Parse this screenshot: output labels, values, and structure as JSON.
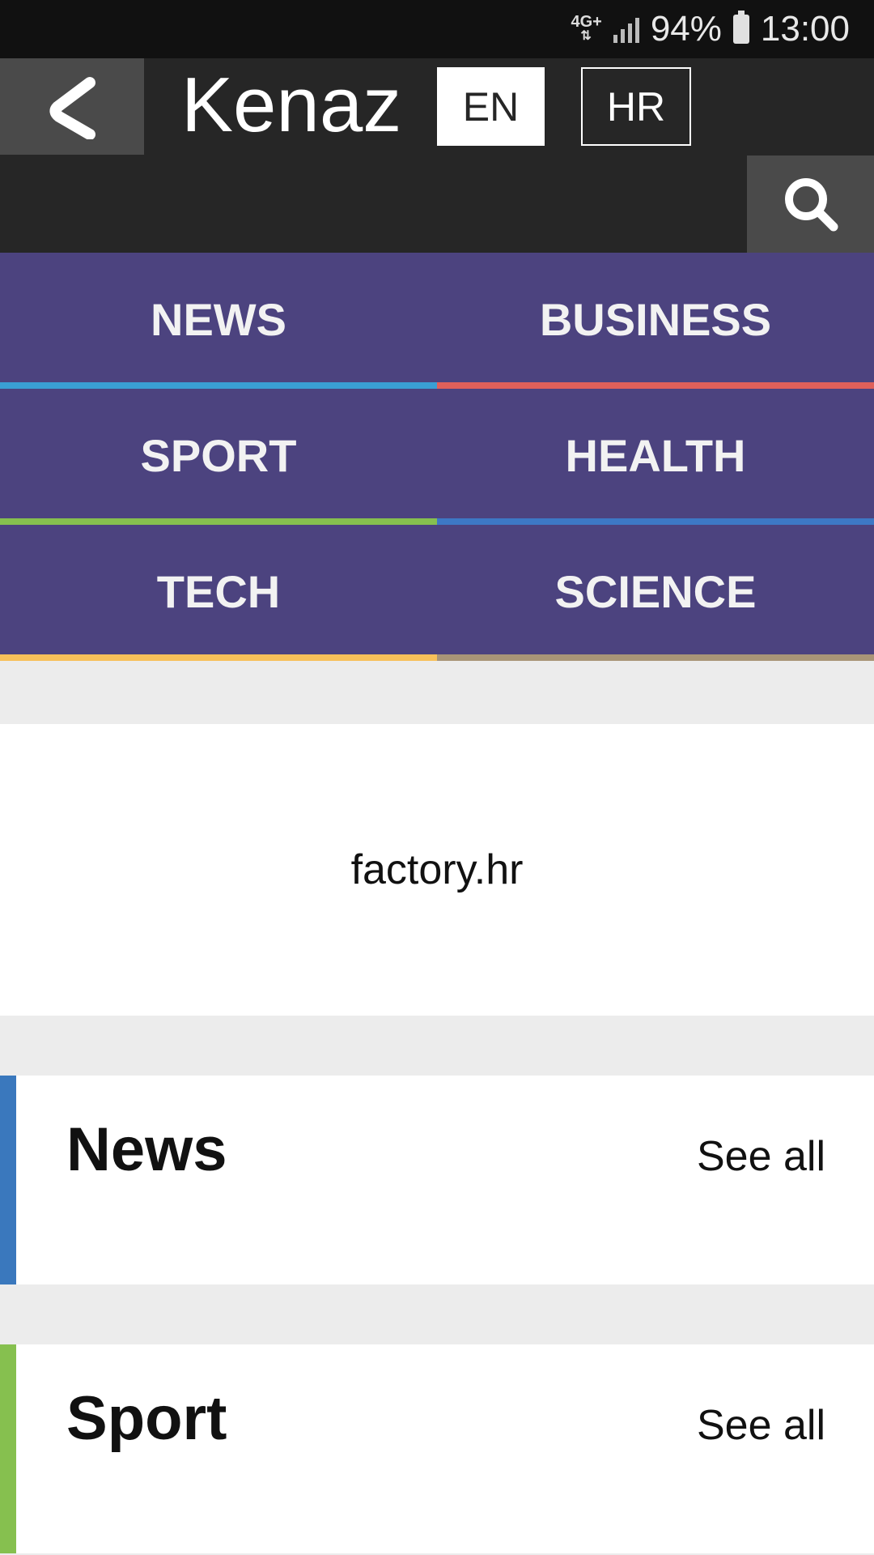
{
  "status_bar": {
    "network": "4G+",
    "network_arrows": "⇅",
    "battery_percent": "94%",
    "time": "13:00",
    "icons": [
      "signal-icon",
      "battery-icon"
    ]
  },
  "header": {
    "title": "Kenaz",
    "languages": [
      {
        "label": "EN",
        "selected": true
      },
      {
        "label": "HR",
        "selected": false
      }
    ],
    "icons": [
      "back-arrow-icon",
      "search-icon"
    ]
  },
  "categories": [
    {
      "label": "NEWS",
      "color": "#3a9fd4"
    },
    {
      "label": "BUSINESS",
      "color": "#e0605a"
    },
    {
      "label": "SPORT",
      "color": "#86c04f"
    },
    {
      "label": "HEALTH",
      "color": "#3d78c5"
    },
    {
      "label": "TECH",
      "color": "#f7c05a"
    },
    {
      "label": "SCIENCE",
      "color": "#a99577"
    }
  ],
  "banner": {
    "text": "factory.hr"
  },
  "sections": [
    {
      "title": "News",
      "see_all": "See all",
      "accent": "#3a78bd"
    },
    {
      "title": "Sport",
      "see_all": "See all",
      "accent": "#86c04f"
    }
  ]
}
